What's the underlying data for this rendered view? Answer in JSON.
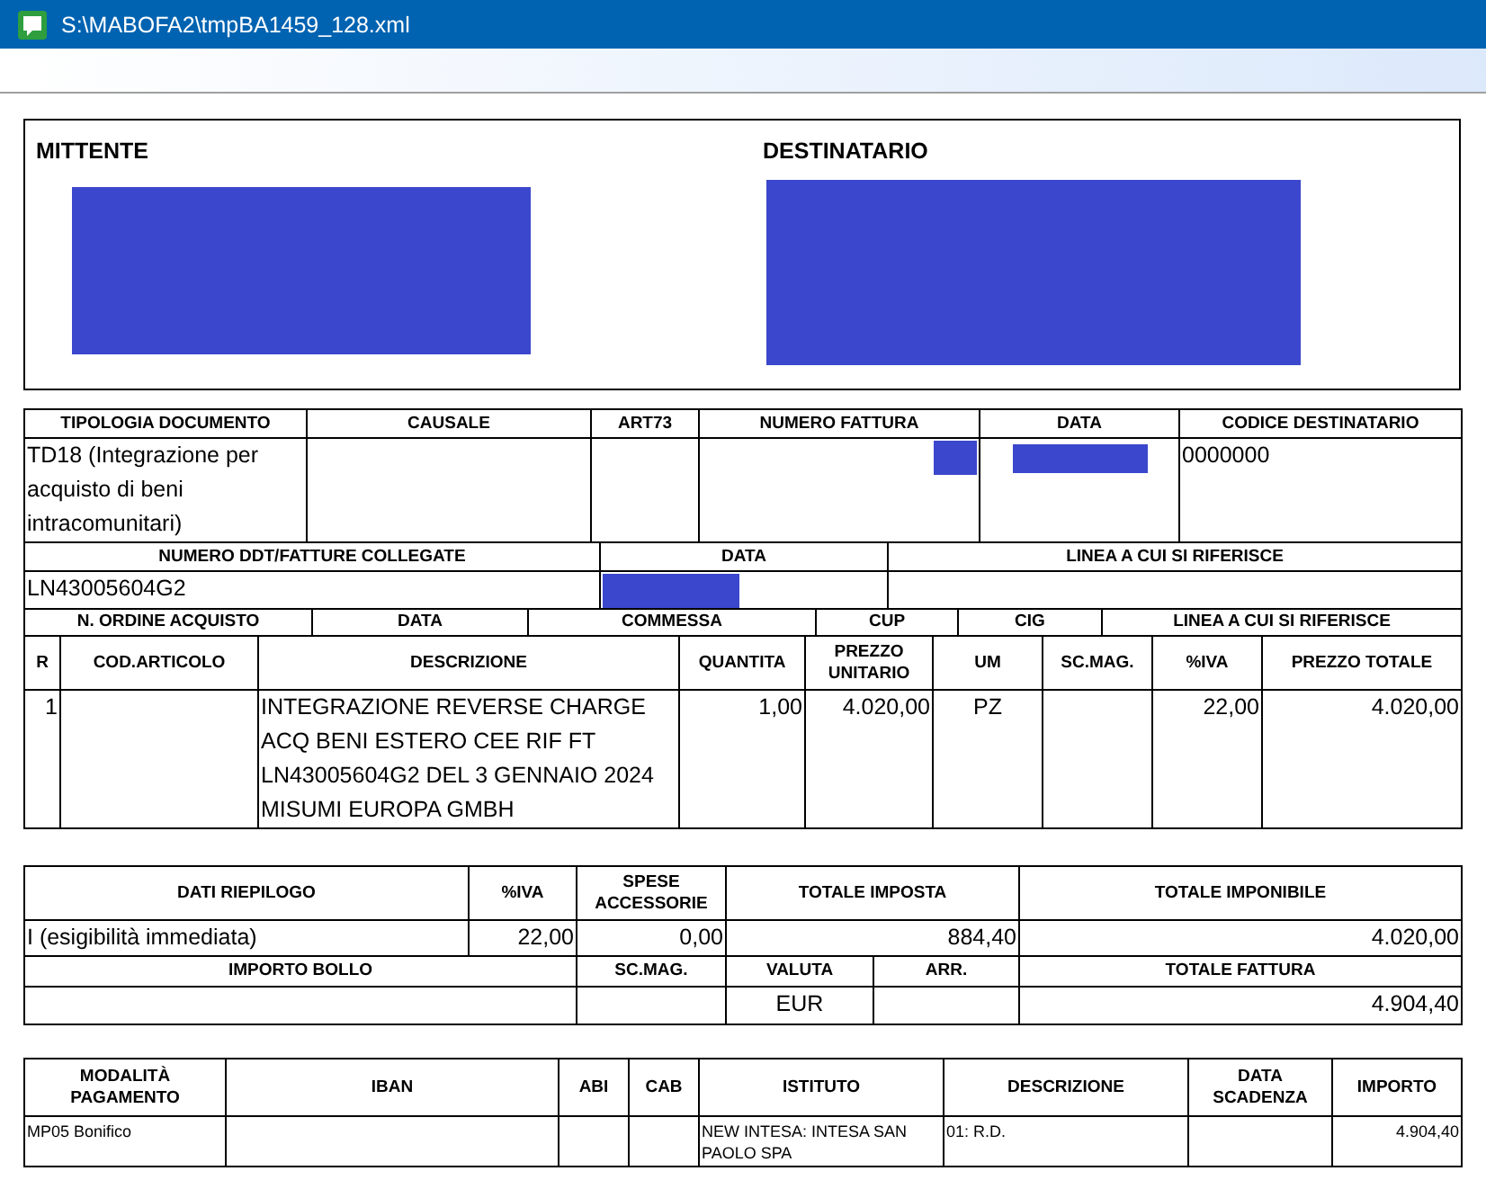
{
  "window": {
    "title": "S:\\MABOFA2\\tmpBA1459_128.xml"
  },
  "parties": [
    {
      "label": "MITTENTE",
      "redacted": true
    },
    {
      "label": "DESTINATARIO",
      "redacted": true
    }
  ],
  "header_table": [
    {
      "columns": [
        "TIPOLOGIA DOCUMENTO",
        "CAUSALE",
        "ART73",
        "NUMERO FATTURA",
        "DATA",
        "CODICE DESTINATARIO"
      ],
      "rows": [
        [
          "TD18 (Integrazione per acquisto di beni intracomunitari)",
          null,
          null,
          {
            "kind": "redacted"
          },
          {
            "kind": "redacted"
          },
          "0000000"
        ]
      ]
    },
    {
      "columns": [
        "NUMERO DDT/FATTURE COLLEGATE",
        "DATA",
        "LINEA A CUI SI RIFERISCE"
      ],
      "rows": [
        [
          "LN43005604G2",
          {
            "kind": "redacted"
          },
          null
        ]
      ]
    },
    {
      "columns": [
        "N. ORDINE ACQUISTO",
        "DATA",
        "COMMESSA",
        "CUP",
        "CIG",
        "LINEA A CUI SI RIFERISCE"
      ]
    },
    {
      "columns": [
        "R",
        "COD.ARTICOLO",
        "DESCRIZIONE",
        "QUANTITA",
        "PREZZO UNITARIO",
        "UM",
        "SC.MAG.",
        "%IVA",
        "PREZZO TOTALE"
      ],
      "rows": [
        [
          "1",
          null,
          "INTEGRAZIONE REVERSE CHARGE ACQ BENI ESTERO CEE RIF FT LN43005604G2 DEL 3 GENNAIO 2024 MISUMI EUROPA GMBH",
          "1,00",
          "4.020,00",
          "PZ",
          null,
          "22,00",
          "4.020,00"
        ]
      ]
    }
  ],
  "summary_table": [
    {
      "columns": [
        "DATI RIEPILOGO",
        "%IVA",
        "SPESE ACCESSORIE",
        "TOTALE IMPOSTA",
        "TOTALE IMPONIBILE"
      ],
      "rows": [
        [
          "I (esigibilità immediata)",
          "22,00",
          "0,00",
          "884,40",
          "4.020,00"
        ]
      ]
    },
    {
      "columns": [
        "IMPORTO BOLLO",
        "SC.MAG.",
        "VALUTA",
        "ARR.",
        "TOTALE FATTURA"
      ],
      "rows": [
        [
          null,
          null,
          "EUR",
          null,
          "4.904,40"
        ]
      ]
    }
  ],
  "payment_table": [
    {
      "columns": [
        "MODALITÀ PAGAMENTO",
        "IBAN",
        "ABI",
        "CAB",
        "ISTITUTO",
        "DESCRIZIONE",
        "DATA SCADENZA",
        "IMPORTO"
      ],
      "rows": [
        [
          "MP05 Bonifico",
          null,
          null,
          null,
          "NEW INTESA: INTESA SAN PAOLO SPA",
          "01: R.D.",
          null,
          "4.904,40"
        ]
      ]
    }
  ]
}
